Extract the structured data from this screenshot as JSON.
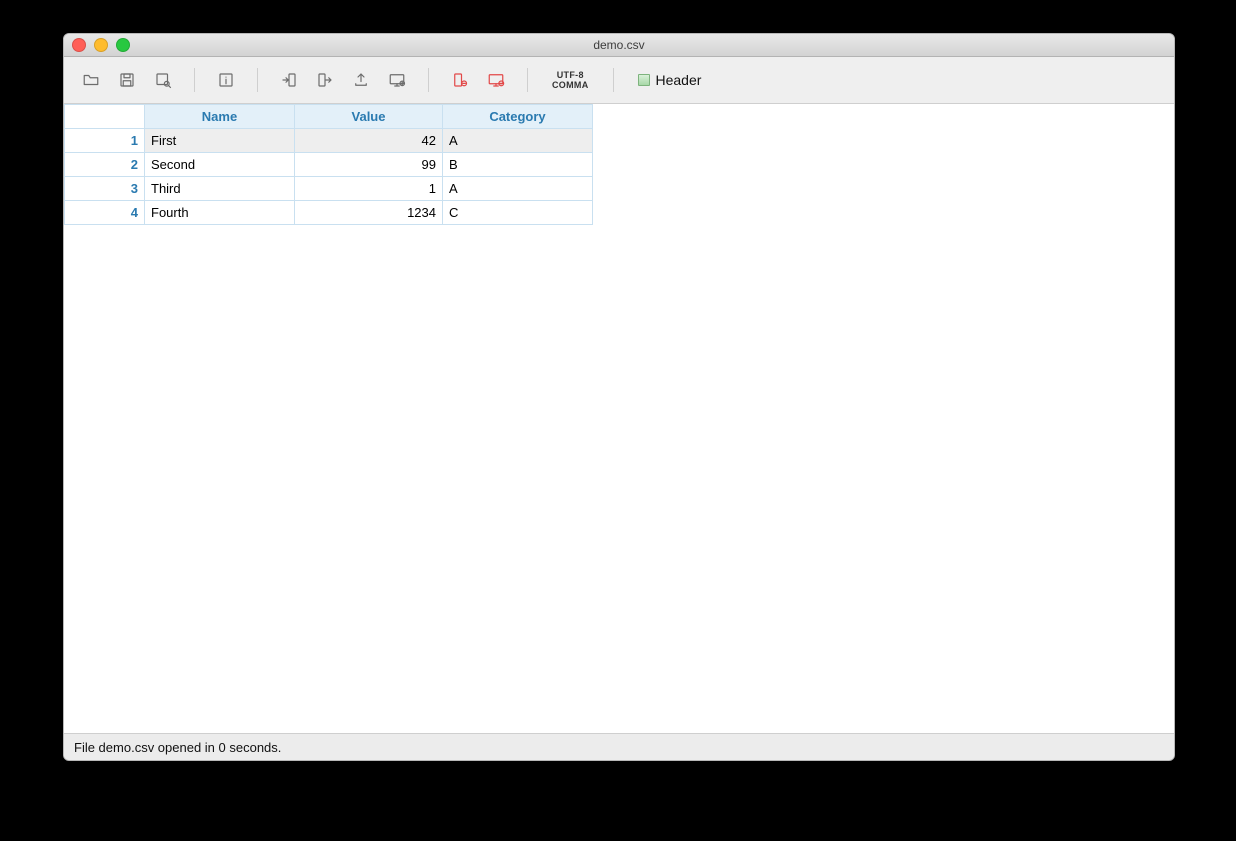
{
  "window": {
    "title": "demo.csv"
  },
  "toolbar": {
    "encoding_line1": "UTF-8",
    "encoding_line2": "COMMA",
    "header_label": "Header"
  },
  "table": {
    "columns": [
      "Name",
      "Value",
      "Category"
    ],
    "rows": [
      {
        "num": "1",
        "name": "First",
        "value": "42",
        "category": "A",
        "selected": true
      },
      {
        "num": "2",
        "name": "Second",
        "value": "99",
        "category": "B",
        "selected": false
      },
      {
        "num": "3",
        "name": "Third",
        "value": "1",
        "category": "A",
        "selected": false
      },
      {
        "num": "4",
        "name": "Fourth",
        "value": "1234",
        "category": "C",
        "selected": false
      }
    ]
  },
  "status": {
    "text": "File demo.csv opened in 0 seconds."
  }
}
